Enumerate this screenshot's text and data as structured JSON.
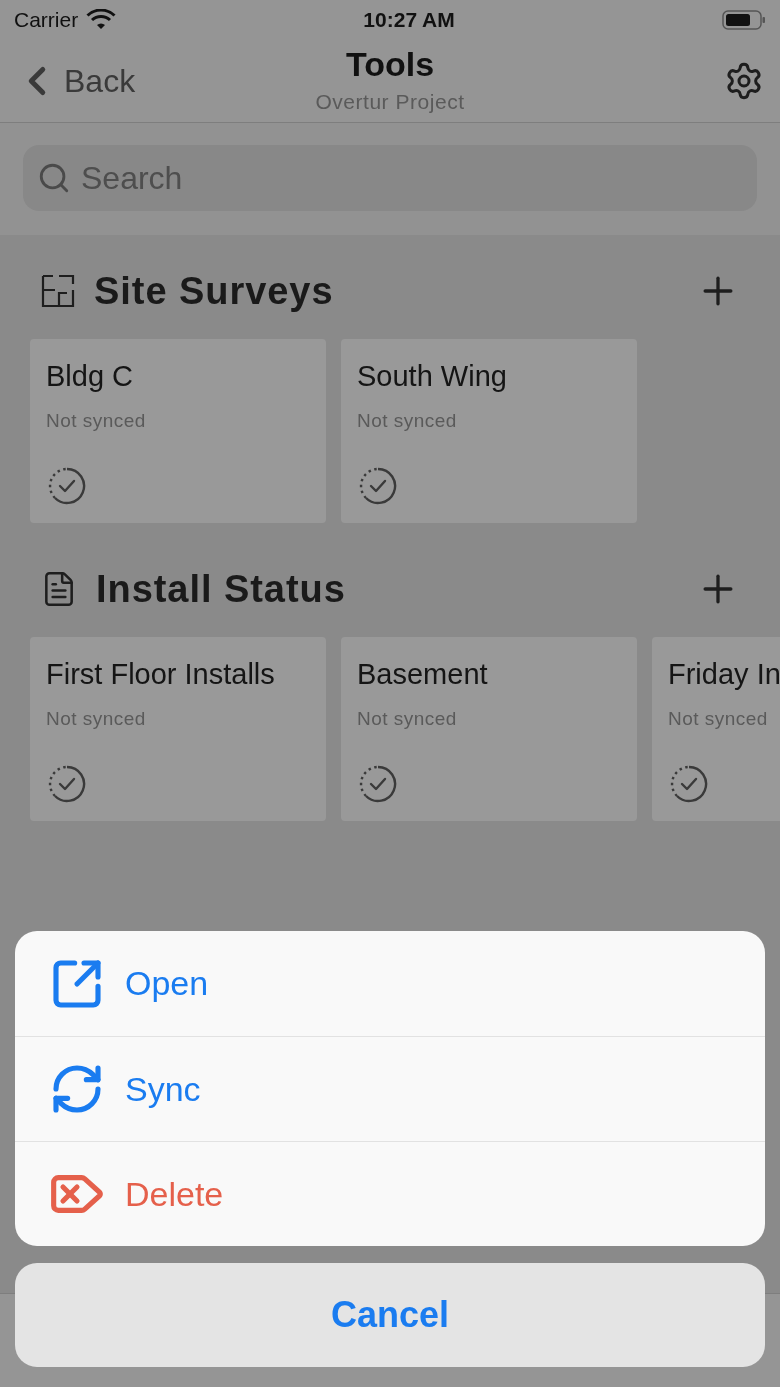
{
  "status_bar": {
    "carrier": "Carrier",
    "time": "10:27 AM"
  },
  "nav": {
    "back": "Back",
    "title": "Tools",
    "subtitle": "Overtur Project"
  },
  "search": {
    "placeholder": "Search"
  },
  "sections": [
    {
      "title": "Site Surveys",
      "kind": "floorplan",
      "cards": [
        {
          "name": "Bldg C",
          "status": "Not synced"
        },
        {
          "name": "South Wing",
          "status": "Not synced"
        }
      ]
    },
    {
      "title": "Install Status",
      "kind": "document",
      "cards": [
        {
          "name": "First Floor Installs",
          "status": "Not synced"
        },
        {
          "name": "Basement",
          "status": "Not synced"
        },
        {
          "name": "Friday In",
          "status": "Not synced"
        }
      ]
    }
  ],
  "action_sheet": {
    "actions": [
      {
        "label": "Open",
        "kind": "open"
      },
      {
        "label": "Sync",
        "kind": "sync"
      },
      {
        "label": "Delete",
        "kind": "delete"
      }
    ],
    "cancel": "Cancel"
  }
}
